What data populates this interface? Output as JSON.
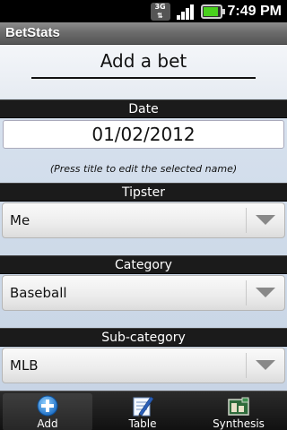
{
  "status_bar": {
    "network_label": "3G",
    "time": "7:49 PM"
  },
  "app": {
    "title": "BetStats"
  },
  "page": {
    "title": "Add a bet"
  },
  "date": {
    "header": "Date",
    "value": "01/02/2012"
  },
  "hint": "(Press title to edit the selected name)",
  "tipster": {
    "header": "Tipster",
    "value": "Me"
  },
  "category": {
    "header": "Category",
    "value": "Baseball"
  },
  "subcategory": {
    "header": "Sub-category",
    "value": "MLB"
  },
  "tabs": [
    {
      "label": "Add",
      "icon": "add-icon",
      "selected": true
    },
    {
      "label": "Table",
      "icon": "table-icon",
      "selected": false
    },
    {
      "label": "Synthesis",
      "icon": "synthesis-icon",
      "selected": false
    }
  ],
  "colors": {
    "status_bar": "#000000",
    "title_bar": "#6c6c6c",
    "section_header": "#1b1b1b",
    "battery": "#49d11d"
  }
}
